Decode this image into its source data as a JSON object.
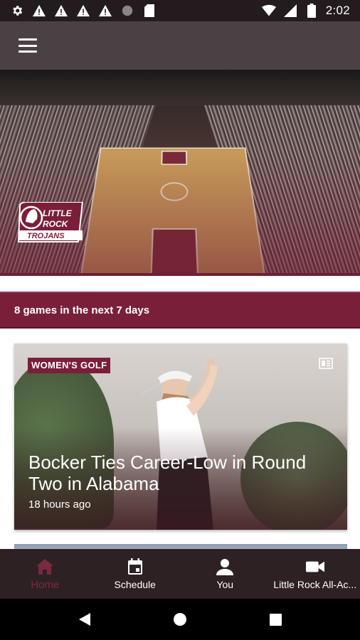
{
  "status_bar": {
    "time": "2:02",
    "left_icons": [
      "settings-icon",
      "warning-icon",
      "warning-icon",
      "warning-icon",
      "warning-icon",
      "circle-icon",
      "sd-card-icon"
    ],
    "right_icons": [
      "wifi-icon",
      "signal-icon",
      "battery-icon"
    ]
  },
  "app_bar": {
    "menu_icon": "hamburger-menu-icon"
  },
  "hero": {
    "logo_line1": "LITTLE",
    "logo_line2": "ROCK",
    "logo_line3": "TROJANS"
  },
  "games_banner": {
    "text": "8 games in the next 7 days"
  },
  "news_card": {
    "tag": "WOMEN'S GOLF",
    "title": "Bocker Ties Career-Low in Round Two in Alabama",
    "time": "18 hours ago",
    "type_icon": "article-icon"
  },
  "bottom_nav": {
    "items": [
      {
        "label": "Home",
        "icon": "home-icon",
        "active": true
      },
      {
        "label": "Schedule",
        "icon": "calendar-icon",
        "active": false
      },
      {
        "label": "You",
        "icon": "person-icon",
        "active": false
      },
      {
        "label": "Little Rock All-Ac...",
        "icon": "video-camera-icon",
        "active": false
      }
    ]
  },
  "colors": {
    "brand": "#7a1f3a",
    "app_bar": "#4a4144",
    "bottom_nav": "#2e2124",
    "nav_active": "#7a2a3e"
  }
}
